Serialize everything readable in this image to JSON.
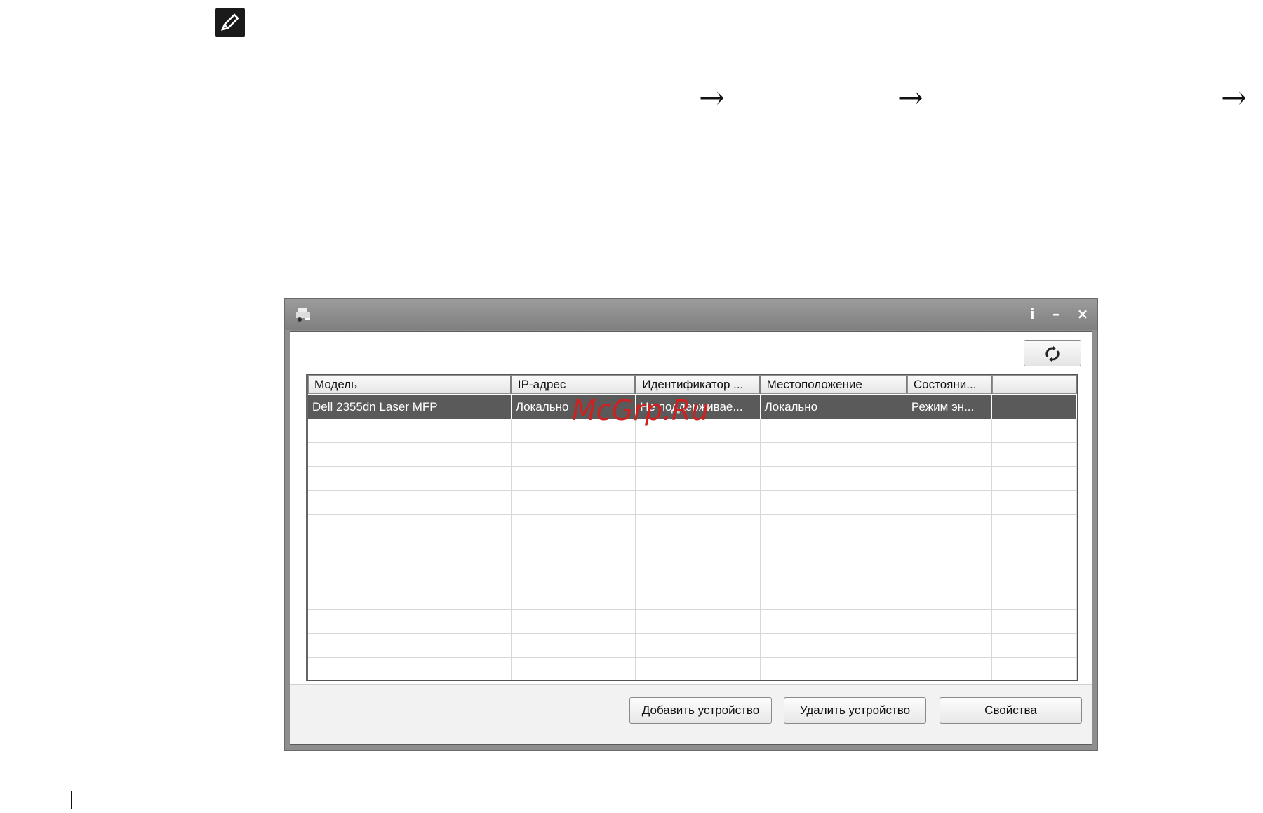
{
  "table": {
    "columns": [
      "Модель",
      "IP-адрес",
      "Идентификатор ...",
      "Местоположение",
      "Состояни...",
      ""
    ],
    "rows": [
      [
        "Dell 2355dn Laser MFP",
        "Локально",
        "Не поддерживае...",
        "Локально",
        "Режим эн...",
        ""
      ]
    ]
  },
  "buttons": {
    "add": "Добавить устройство",
    "remove": "Удалить устройство",
    "properties": "Свойства"
  },
  "titlebar": {
    "info": "i",
    "minimize": "–",
    "close": "×"
  },
  "watermark": "McGrp.Ru",
  "arrows": [
    "→",
    "→",
    "→"
  ],
  "icons": {
    "note": "pencil-note-icon",
    "app": "printer-app-icon",
    "refresh": "refresh-icon"
  },
  "colors": {
    "selected_row": "#5a5a5a",
    "watermark": "#cc2222"
  }
}
